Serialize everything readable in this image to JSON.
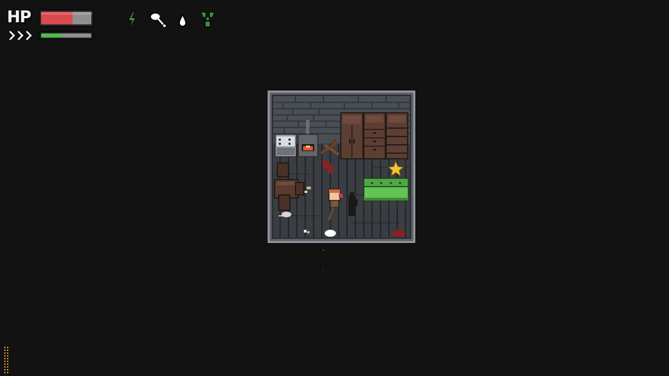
{
  "hud": {
    "hp_label": "HP",
    "hp_fraction": 0.62,
    "stamina_fraction": 0.4,
    "hp_color": "#d94a4f",
    "stamina_color": "#4fb84a",
    "stamina_icon": "chevrons-right-icon",
    "status_effects": [
      {
        "icon": "lightning-bolt-icon",
        "color": "#3f8f3a"
      },
      {
        "icon": "drumstick-food-icon",
        "color": "#ffffff"
      },
      {
        "icon": "water-drop-icon",
        "color": "#ffffff"
      },
      {
        "icon": "radiation-icon",
        "color": "#3f8f3a"
      }
    ]
  },
  "scene": {
    "room": "cabin-interior",
    "objects": [
      "stove",
      "wood-burner",
      "firewood-pile",
      "wardrobe",
      "dresser",
      "bookshelf",
      "star-item",
      "green-couch",
      "table",
      "chair",
      "player",
      "shadow-figure",
      "blood-stain",
      "skull-remains"
    ]
  }
}
